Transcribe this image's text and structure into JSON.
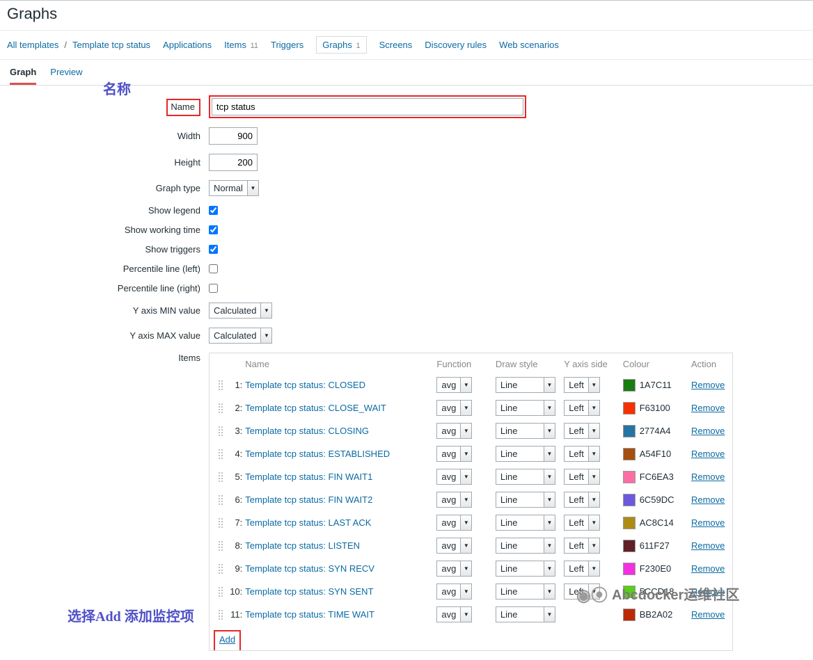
{
  "page_title": "Graphs",
  "breadcrumb": {
    "all_templates": "All templates",
    "template": "Template tcp status",
    "applications": "Applications",
    "items": "Items",
    "items_count": "11",
    "triggers": "Triggers",
    "graphs": "Graphs",
    "graphs_count": "1",
    "screens": "Screens",
    "discovery": "Discovery rules",
    "webscenarios": "Web scenarios"
  },
  "subtabs": {
    "graph": "Graph",
    "preview": "Preview"
  },
  "annotations": {
    "name_cn": "名称",
    "add_cn": "选择Add  添加监控项"
  },
  "form": {
    "name_label": "Name",
    "name_value": "tcp status",
    "width_label": "Width",
    "width_value": "900",
    "height_label": "Height",
    "height_value": "200",
    "graph_type_label": "Graph type",
    "graph_type_value": "Normal",
    "show_legend_label": "Show legend",
    "show_working_time_label": "Show working time",
    "show_triggers_label": "Show triggers",
    "percentile_left_label": "Percentile line (left)",
    "percentile_right_label": "Percentile line (right)",
    "ymin_label": "Y axis MIN value",
    "ymin_value": "Calculated",
    "ymax_label": "Y axis MAX value",
    "ymax_value": "Calculated",
    "items_label": "Items"
  },
  "items_header": {
    "name": "Name",
    "function": "Function",
    "draw_style": "Draw style",
    "y_axis_side": "Y axis side",
    "colour": "Colour",
    "action": "Action"
  },
  "items": [
    {
      "idx": "1:",
      "name": "Template tcp status: CLOSED",
      "fn": "avg",
      "draw": "Line",
      "side": "Left",
      "color": "1A7C11",
      "hex": "#1A7C11",
      "action": "Remove"
    },
    {
      "idx": "2:",
      "name": "Template tcp status: CLOSE_WAIT",
      "fn": "avg",
      "draw": "Line",
      "side": "Left",
      "color": "F63100",
      "hex": "#F63100",
      "action": "Remove"
    },
    {
      "idx": "3:",
      "name": "Template tcp status: CLOSING",
      "fn": "avg",
      "draw": "Line",
      "side": "Left",
      "color": "2774A4",
      "hex": "#2774A4",
      "action": "Remove"
    },
    {
      "idx": "4:",
      "name": "Template tcp status: ESTABLISHED",
      "fn": "avg",
      "draw": "Line",
      "side": "Left",
      "color": "A54F10",
      "hex": "#A54F10",
      "action": "Remove"
    },
    {
      "idx": "5:",
      "name": "Template tcp status: FIN WAIT1",
      "fn": "avg",
      "draw": "Line",
      "side": "Left",
      "color": "FC6EA3",
      "hex": "#FC6EA3",
      "action": "Remove"
    },
    {
      "idx": "6:",
      "name": "Template tcp status: FIN WAIT2",
      "fn": "avg",
      "draw": "Line",
      "side": "Left",
      "color": "6C59DC",
      "hex": "#6C59DC",
      "action": "Remove"
    },
    {
      "idx": "7:",
      "name": "Template tcp status: LAST ACK",
      "fn": "avg",
      "draw": "Line",
      "side": "Left",
      "color": "AC8C14",
      "hex": "#AC8C14",
      "action": "Remove"
    },
    {
      "idx": "8:",
      "name": "Template tcp status: LISTEN",
      "fn": "avg",
      "draw": "Line",
      "side": "Left",
      "color": "611F27",
      "hex": "#611F27",
      "action": "Remove"
    },
    {
      "idx": "9:",
      "name": "Template tcp status: SYN RECV",
      "fn": "avg",
      "draw": "Line",
      "side": "Left",
      "color": "F230E0",
      "hex": "#F230E0",
      "action": "Remove"
    },
    {
      "idx": "10:",
      "name": "Template tcp status: SYN SENT",
      "fn": "avg",
      "draw": "Line",
      "side": "Left",
      "color": "5CCD18",
      "hex": "#5CCD18",
      "action": "Remove"
    },
    {
      "idx": "11:",
      "name": "Template tcp status: TIME WAIT",
      "fn": "avg",
      "draw": "Line",
      "side": "",
      "color": "BB2A02",
      "hex": "#BB2A02",
      "action": "Remove"
    }
  ],
  "add_label": "Add",
  "watermark": "Abcdocker运维社区"
}
